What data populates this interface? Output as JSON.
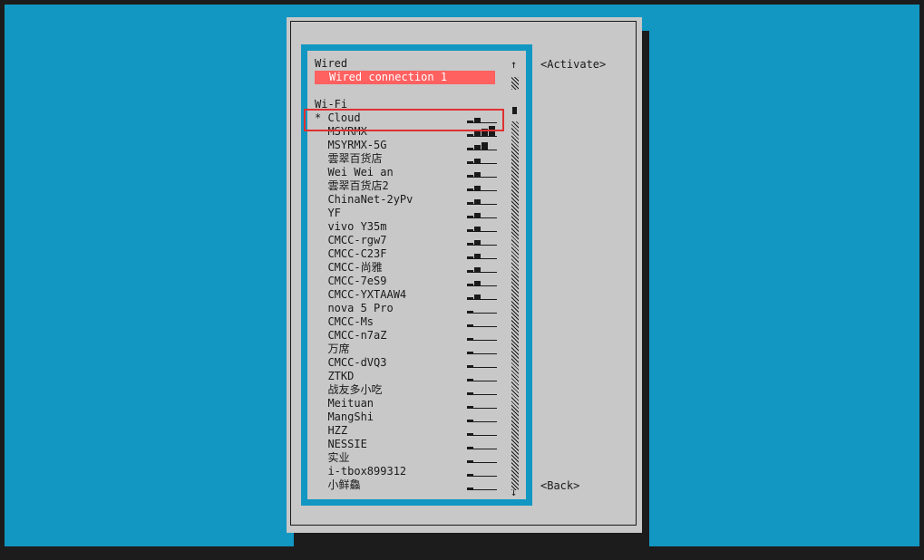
{
  "wired": {
    "header": "Wired",
    "connections": [
      "Wired connection 1"
    ]
  },
  "wifi": {
    "header": "Wi-Fi",
    "networks": [
      {
        "name": "* Cloud",
        "bars": 2
      },
      {
        "name": "  MSYRMX",
        "bars": 4
      },
      {
        "name": "  MSYRMX-5G",
        "bars": 3
      },
      {
        "name": "  雲翠百货店",
        "bars": 2
      },
      {
        "name": "  Wei Wei an",
        "bars": 2
      },
      {
        "name": "  雲翠百货店2",
        "bars": 2
      },
      {
        "name": "  ChinaNet-2yPv",
        "bars": 2
      },
      {
        "name": "  YF",
        "bars": 2
      },
      {
        "name": "  vivo Y35m",
        "bars": 2
      },
      {
        "name": "  CMCC-rgw7",
        "bars": 2
      },
      {
        "name": "  CMCC-C23F",
        "bars": 2
      },
      {
        "name": "  CMCC-尚雅",
        "bars": 2
      },
      {
        "name": "  CMCC-7eS9",
        "bars": 2
      },
      {
        "name": "  CMCC-YXTAAW4",
        "bars": 2
      },
      {
        "name": "  nova 5 Pro",
        "bars": 1
      },
      {
        "name": "  CMCC-Ms",
        "bars": 1
      },
      {
        "name": "  CMCC-n7aZ",
        "bars": 1
      },
      {
        "name": "  万席",
        "bars": 1
      },
      {
        "name": "  CMCC-dVQ3",
        "bars": 1
      },
      {
        "name": "  ZTKD",
        "bars": 1
      },
      {
        "name": "  战友多小吃",
        "bars": 1
      },
      {
        "name": "  Meituan",
        "bars": 1
      },
      {
        "name": "  MangShi",
        "bars": 1
      },
      {
        "name": "  HZZ",
        "bars": 1
      },
      {
        "name": "  NESSIE",
        "bars": 1
      },
      {
        "name": "  实业",
        "bars": 1
      },
      {
        "name": "  i-tbox899312",
        "bars": 1
      },
      {
        "name": "  小鲜鱻",
        "bars": 1
      }
    ]
  },
  "scrollbar": {
    "up_arrow": "↑",
    "down_arrow": "↓"
  },
  "buttons": {
    "activate": "<Activate>",
    "back": "<Back>"
  },
  "colors": {
    "terminal_bg": "#1197c2",
    "dialog_bg": "#c8c8c8",
    "selected_bg": "#ff6060",
    "highlight": "#e03030"
  }
}
